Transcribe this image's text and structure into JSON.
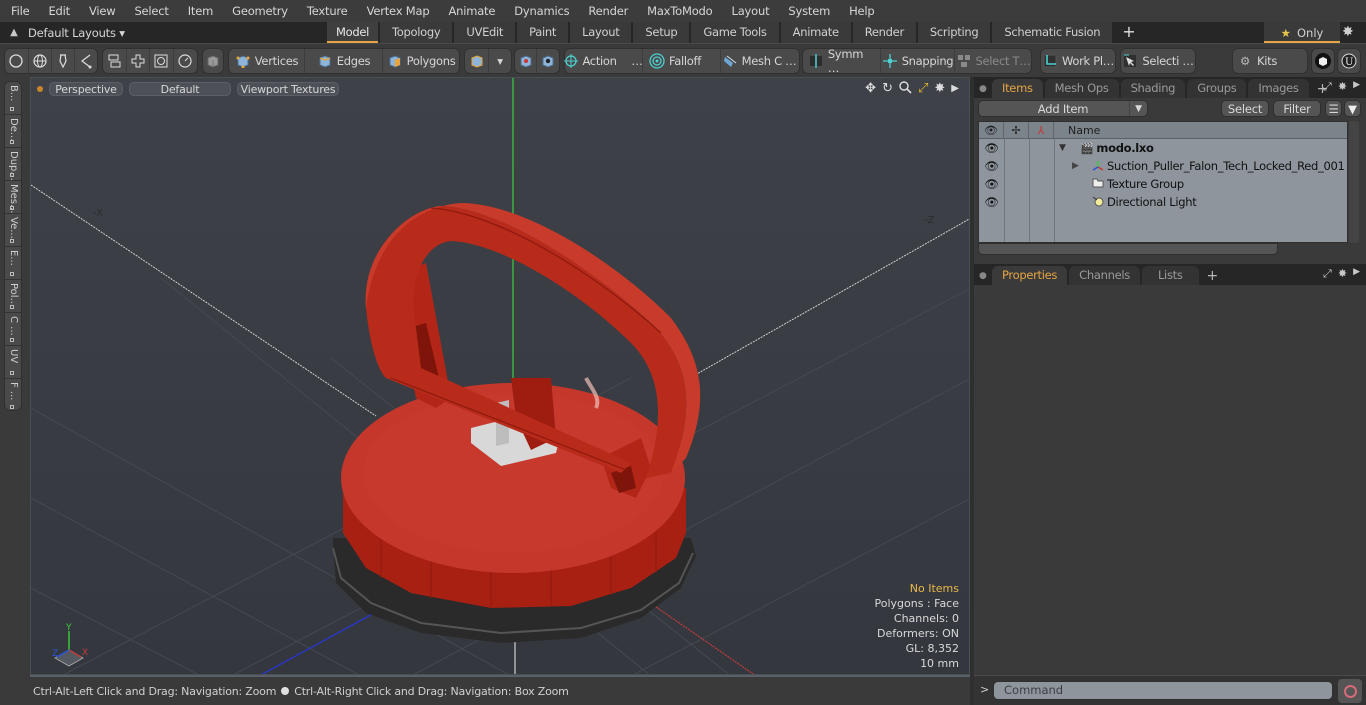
{
  "menubar": {
    "items": [
      "File",
      "Edit",
      "View",
      "Select",
      "Item",
      "Geometry",
      "Texture",
      "Vertex Map",
      "Animate",
      "Dynamics",
      "Render",
      "MaxToModo",
      "Layout",
      "System",
      "Help"
    ]
  },
  "layoutbar": {
    "layouts_label": "Default Layouts",
    "tabs": [
      {
        "label": "Model",
        "active": true
      },
      {
        "label": "Topology"
      },
      {
        "label": "UVEdit"
      },
      {
        "label": "Paint"
      },
      {
        "label": "Layout"
      },
      {
        "label": "Setup"
      },
      {
        "label": "Game Tools"
      },
      {
        "label": "Animate"
      },
      {
        "label": "Render"
      },
      {
        "label": "Scripting"
      },
      {
        "label": "Schematic Fusion"
      }
    ],
    "add_tab": "+",
    "only_label": "Only"
  },
  "toolbar": {
    "vertices": "Vertices",
    "edges": "Edges",
    "polygons": "Polygons",
    "action": "Action",
    "action_more": "…",
    "falloff": "Falloff",
    "mesh_c": "Mesh C …",
    "symm": "Symm …",
    "snapping": "Snapping",
    "select_t": "Select T…",
    "work_pl": "Work Pl…",
    "selecti": "Selecti …",
    "kits": "Kits"
  },
  "leftbar": {
    "tabs": [
      "B...",
      "De...",
      "Dup...",
      "Mes...",
      "Ve...",
      "E...",
      "Pol...",
      "C ...",
      "UV",
      "F ..."
    ]
  },
  "viewport": {
    "view_mode": "Perspective",
    "shading": "Default",
    "textures": "Viewport Textures",
    "axis_neg_x": "-X",
    "axis_neg_z": "-Z",
    "gizmo": {
      "x": "X",
      "y": "Y",
      "z": "Z"
    },
    "info": {
      "selection": "No Items",
      "polygons": "Polygons : Face",
      "channels": "Channels: 0",
      "deformers": "Deformers: ON",
      "gl": "GL: 8,352",
      "unit": "10 mm"
    },
    "colors": {
      "x_axis": "#c23b3b",
      "y_axis": "#3bcf3b",
      "z_axis": "#2a35c8",
      "model_red": "#c12a1a"
    }
  },
  "statusbar": {
    "hint_left": "Ctrl-Alt-Left Click and Drag: Navigation: Zoom",
    "hint_right": "Ctrl-Alt-Right Click and Drag: Navigation: Box Zoom"
  },
  "items_panel": {
    "tabs": [
      {
        "label": "Items",
        "active": true
      },
      {
        "label": "Mesh Ops"
      },
      {
        "label": "Shading"
      },
      {
        "label": "Groups"
      },
      {
        "label": "Images"
      }
    ],
    "add_tab": "+",
    "add_item": "Add Item",
    "select": "Select",
    "filter": "Filter",
    "column_name": "Name",
    "tree": [
      {
        "name": "modo.lxo",
        "bold": true,
        "icon": "scene-icon",
        "level": 0
      },
      {
        "name": "Suction_Puller_Falon_Tech_Locked_Red_001",
        "icon": "mesh-locator-icon",
        "level": 1,
        "expandable": true
      },
      {
        "name": "Texture Group",
        "icon": "texture-group-icon",
        "level": 1
      },
      {
        "name": "Directional Light",
        "icon": "light-icon",
        "level": 1
      }
    ]
  },
  "properties_panel": {
    "tabs": [
      {
        "label": "Properties",
        "active": true
      },
      {
        "label": "Channels"
      },
      {
        "label": "Lists"
      }
    ],
    "add_tab": "+"
  },
  "command": {
    "prompt": ">",
    "placeholder": "Command"
  }
}
